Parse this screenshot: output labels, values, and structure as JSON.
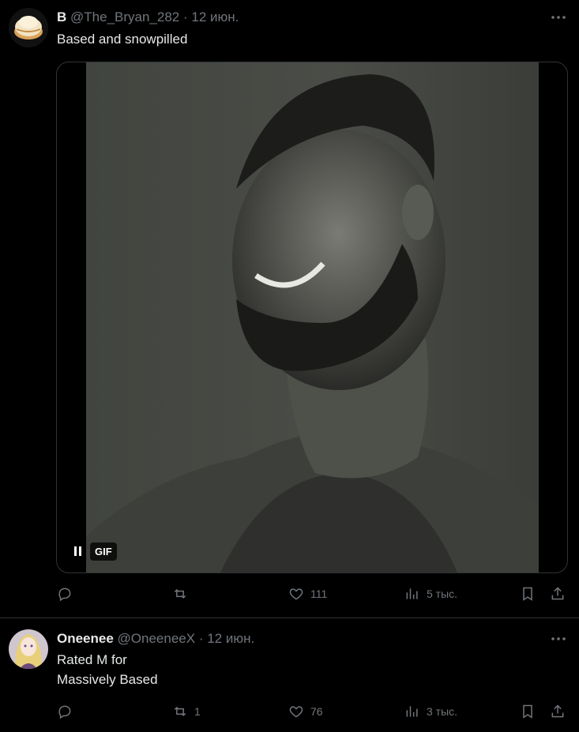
{
  "tweets": [
    {
      "name": "B",
      "handle": "@The_Bryan_282",
      "separator": "·",
      "date": "12 июн.",
      "text": "Based and snowpilled",
      "media_badge": "GIF",
      "actions": {
        "reply": "",
        "retweet": "",
        "like": "111",
        "views": "5 тыс."
      }
    },
    {
      "name": "Oneenee",
      "handle": "@OneeneeX",
      "separator": "·",
      "date": "12 июн.",
      "text_lines": [
        "Rated M for",
        "Massively Based"
      ],
      "actions": {
        "reply": "",
        "retweet": "1",
        "like": "76",
        "views": "3 тыс."
      }
    }
  ],
  "icons": [
    "more-icon",
    "reply-icon",
    "retweet-icon",
    "like-icon",
    "views-icon",
    "bookmark-icon",
    "share-icon",
    "pause-icon"
  ]
}
